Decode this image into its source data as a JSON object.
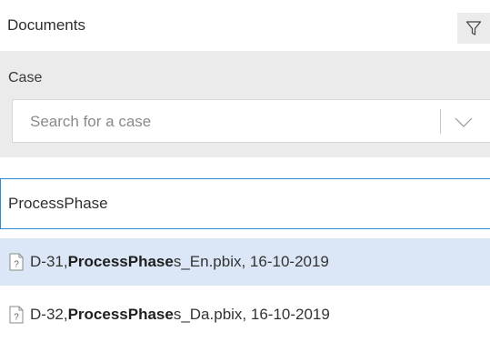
{
  "header": {
    "title": "Documents",
    "filter_icon": "filter-funnel-icon"
  },
  "case_filter": {
    "label": "Case",
    "placeholder": "Search for a case",
    "dropdown_icon": "chevron-down-icon"
  },
  "search": {
    "value": "ProcessPhase"
  },
  "results": [
    {
      "prefix": "D-31, ",
      "match": "ProcessPhase",
      "suffix": "s_En.pbix, 16-10-2019",
      "icon": "unknown-file-icon",
      "selected": true
    },
    {
      "prefix": "D-32, ",
      "match": "ProcessPhase",
      "suffix": "s_Da.pbix, 16-10-2019",
      "icon": "unknown-file-icon",
      "selected": false
    }
  ],
  "colors": {
    "panel_bg": "#ebebeb",
    "focus_border": "#2a8cd6",
    "selected_row_bg": "#dbe7f6"
  }
}
